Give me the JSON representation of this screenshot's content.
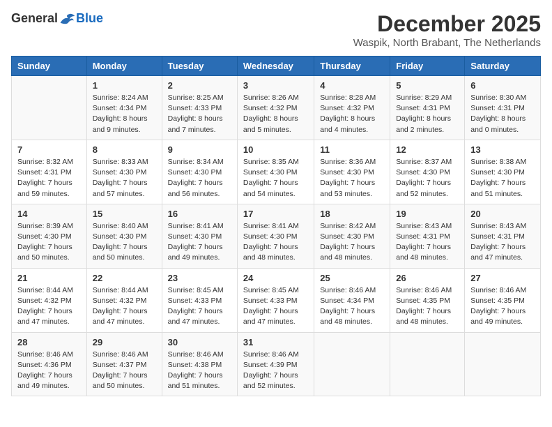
{
  "header": {
    "logo_general": "General",
    "logo_blue": "Blue",
    "title": "December 2025",
    "location": "Waspik, North Brabant, The Netherlands"
  },
  "columns": [
    "Sunday",
    "Monday",
    "Tuesday",
    "Wednesday",
    "Thursday",
    "Friday",
    "Saturday"
  ],
  "weeks": [
    [
      {
        "day": "",
        "sunrise": "",
        "sunset": "",
        "daylight": ""
      },
      {
        "day": "1",
        "sunrise": "Sunrise: 8:24 AM",
        "sunset": "Sunset: 4:34 PM",
        "daylight": "Daylight: 8 hours and 9 minutes."
      },
      {
        "day": "2",
        "sunrise": "Sunrise: 8:25 AM",
        "sunset": "Sunset: 4:33 PM",
        "daylight": "Daylight: 8 hours and 7 minutes."
      },
      {
        "day": "3",
        "sunrise": "Sunrise: 8:26 AM",
        "sunset": "Sunset: 4:32 PM",
        "daylight": "Daylight: 8 hours and 5 minutes."
      },
      {
        "day": "4",
        "sunrise": "Sunrise: 8:28 AM",
        "sunset": "Sunset: 4:32 PM",
        "daylight": "Daylight: 8 hours and 4 minutes."
      },
      {
        "day": "5",
        "sunrise": "Sunrise: 8:29 AM",
        "sunset": "Sunset: 4:31 PM",
        "daylight": "Daylight: 8 hours and 2 minutes."
      },
      {
        "day": "6",
        "sunrise": "Sunrise: 8:30 AM",
        "sunset": "Sunset: 4:31 PM",
        "daylight": "Daylight: 8 hours and 0 minutes."
      }
    ],
    [
      {
        "day": "7",
        "sunrise": "Sunrise: 8:32 AM",
        "sunset": "Sunset: 4:31 PM",
        "daylight": "Daylight: 7 hours and 59 minutes."
      },
      {
        "day": "8",
        "sunrise": "Sunrise: 8:33 AM",
        "sunset": "Sunset: 4:30 PM",
        "daylight": "Daylight: 7 hours and 57 minutes."
      },
      {
        "day": "9",
        "sunrise": "Sunrise: 8:34 AM",
        "sunset": "Sunset: 4:30 PM",
        "daylight": "Daylight: 7 hours and 56 minutes."
      },
      {
        "day": "10",
        "sunrise": "Sunrise: 8:35 AM",
        "sunset": "Sunset: 4:30 PM",
        "daylight": "Daylight: 7 hours and 54 minutes."
      },
      {
        "day": "11",
        "sunrise": "Sunrise: 8:36 AM",
        "sunset": "Sunset: 4:30 PM",
        "daylight": "Daylight: 7 hours and 53 minutes."
      },
      {
        "day": "12",
        "sunrise": "Sunrise: 8:37 AM",
        "sunset": "Sunset: 4:30 PM",
        "daylight": "Daylight: 7 hours and 52 minutes."
      },
      {
        "day": "13",
        "sunrise": "Sunrise: 8:38 AM",
        "sunset": "Sunset: 4:30 PM",
        "daylight": "Daylight: 7 hours and 51 minutes."
      }
    ],
    [
      {
        "day": "14",
        "sunrise": "Sunrise: 8:39 AM",
        "sunset": "Sunset: 4:30 PM",
        "daylight": "Daylight: 7 hours and 50 minutes."
      },
      {
        "day": "15",
        "sunrise": "Sunrise: 8:40 AM",
        "sunset": "Sunset: 4:30 PM",
        "daylight": "Daylight: 7 hours and 50 minutes."
      },
      {
        "day": "16",
        "sunrise": "Sunrise: 8:41 AM",
        "sunset": "Sunset: 4:30 PM",
        "daylight": "Daylight: 7 hours and 49 minutes."
      },
      {
        "day": "17",
        "sunrise": "Sunrise: 8:41 AM",
        "sunset": "Sunset: 4:30 PM",
        "daylight": "Daylight: 7 hours and 48 minutes."
      },
      {
        "day": "18",
        "sunrise": "Sunrise: 8:42 AM",
        "sunset": "Sunset: 4:30 PM",
        "daylight": "Daylight: 7 hours and 48 minutes."
      },
      {
        "day": "19",
        "sunrise": "Sunrise: 8:43 AM",
        "sunset": "Sunset: 4:31 PM",
        "daylight": "Daylight: 7 hours and 48 minutes."
      },
      {
        "day": "20",
        "sunrise": "Sunrise: 8:43 AM",
        "sunset": "Sunset: 4:31 PM",
        "daylight": "Daylight: 7 hours and 47 minutes."
      }
    ],
    [
      {
        "day": "21",
        "sunrise": "Sunrise: 8:44 AM",
        "sunset": "Sunset: 4:32 PM",
        "daylight": "Daylight: 7 hours and 47 minutes."
      },
      {
        "day": "22",
        "sunrise": "Sunrise: 8:44 AM",
        "sunset": "Sunset: 4:32 PM",
        "daylight": "Daylight: 7 hours and 47 minutes."
      },
      {
        "day": "23",
        "sunrise": "Sunrise: 8:45 AM",
        "sunset": "Sunset: 4:33 PM",
        "daylight": "Daylight: 7 hours and 47 minutes."
      },
      {
        "day": "24",
        "sunrise": "Sunrise: 8:45 AM",
        "sunset": "Sunset: 4:33 PM",
        "daylight": "Daylight: 7 hours and 47 minutes."
      },
      {
        "day": "25",
        "sunrise": "Sunrise: 8:46 AM",
        "sunset": "Sunset: 4:34 PM",
        "daylight": "Daylight: 7 hours and 48 minutes."
      },
      {
        "day": "26",
        "sunrise": "Sunrise: 8:46 AM",
        "sunset": "Sunset: 4:35 PM",
        "daylight": "Daylight: 7 hours and 48 minutes."
      },
      {
        "day": "27",
        "sunrise": "Sunrise: 8:46 AM",
        "sunset": "Sunset: 4:35 PM",
        "daylight": "Daylight: 7 hours and 49 minutes."
      }
    ],
    [
      {
        "day": "28",
        "sunrise": "Sunrise: 8:46 AM",
        "sunset": "Sunset: 4:36 PM",
        "daylight": "Daylight: 7 hours and 49 minutes."
      },
      {
        "day": "29",
        "sunrise": "Sunrise: 8:46 AM",
        "sunset": "Sunset: 4:37 PM",
        "daylight": "Daylight: 7 hours and 50 minutes."
      },
      {
        "day": "30",
        "sunrise": "Sunrise: 8:46 AM",
        "sunset": "Sunset: 4:38 PM",
        "daylight": "Daylight: 7 hours and 51 minutes."
      },
      {
        "day": "31",
        "sunrise": "Sunrise: 8:46 AM",
        "sunset": "Sunset: 4:39 PM",
        "daylight": "Daylight: 7 hours and 52 minutes."
      },
      {
        "day": "",
        "sunrise": "",
        "sunset": "",
        "daylight": ""
      },
      {
        "day": "",
        "sunrise": "",
        "sunset": "",
        "daylight": ""
      },
      {
        "day": "",
        "sunrise": "",
        "sunset": "",
        "daylight": ""
      }
    ]
  ]
}
